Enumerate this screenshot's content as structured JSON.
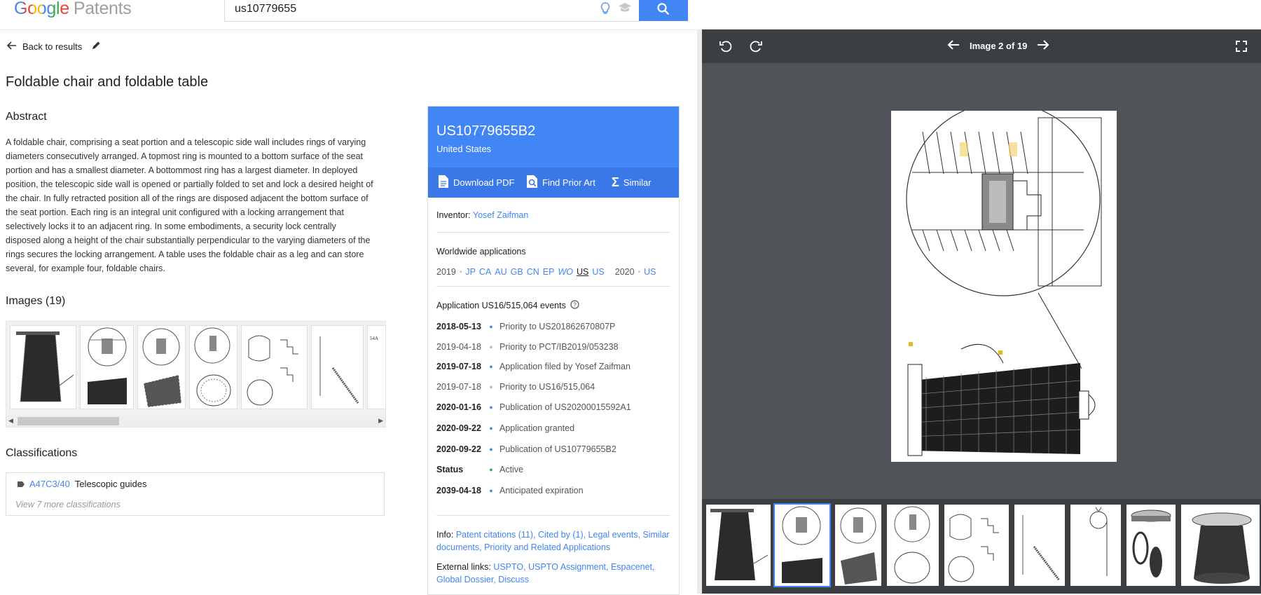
{
  "header": {
    "logo_google": "Google",
    "logo_product": "Patents",
    "search_value": "us10779655"
  },
  "left": {
    "back_label": "Back to results",
    "title": "Foldable chair and foldable table",
    "abstract_heading": "Abstract",
    "abstract_text": "A foldable chair, comprising a seat portion and a telescopic side wall includes rings of varying diameters consecutively arranged. A topmost ring is mounted to a bottom surface of the seat portion and has a smallest diameter. A bottommost ring has a largest diameter. In deployed position, the telescopic side wall is opened or partially folded to set and lock a desired height of the chair. In fully retracted position all of the rings are disposed adjacent the bottom surface of the seat portion. Each ring is an integral unit configured with a locking arrangement that selectively locks it to an adjacent ring. In some embodiments, a security lock centrally disposed along a height of the chair substantially perpendicular to the varying diameters of the rings secures the locking arrangement. A table uses the foldable chair as a leg and can store several, for example four, foldable chairs.",
    "images_heading": "Images (19)",
    "classifications_heading": "Classifications",
    "classification_code": "A47C3/40",
    "classification_desc": "Telescopic guides",
    "classification_more": "View 7 more classifications"
  },
  "card": {
    "patent_number": "US10779655B2",
    "country": "United States",
    "tools": {
      "download_pdf": "Download PDF",
      "find_prior_art": "Find Prior Art",
      "similar": "Similar"
    },
    "inventor_label": "Inventor:",
    "inventor_name": "Yosef Zaifman",
    "worldwide_heading": "Worldwide applications",
    "worldwide_2019": "2019",
    "worldwide_2019_countries": [
      "JP",
      "CA",
      "AU",
      "GB",
      "CN",
      "EP",
      "WO",
      "US",
      "US"
    ],
    "worldwide_2020": "2020",
    "worldwide_2020_countries": [
      "US"
    ],
    "events_heading": "Application US16/515,064 events",
    "events": [
      {
        "date": "2018-05-13",
        "text": "Priority to US201862670807P",
        "light": false
      },
      {
        "date": "2019-04-18",
        "text": "Priority to PCT/IB2019/053238",
        "light": true
      },
      {
        "date": "2019-07-18",
        "text": "Application filed by Yosef Zaifman",
        "light": false
      },
      {
        "date": "2019-07-18",
        "text": "Priority to US16/515,064",
        "light": true
      },
      {
        "date": "2020-01-16",
        "text": "Publication of US20200015592A1",
        "light": false
      },
      {
        "date": "2020-09-22",
        "text": "Application granted",
        "light": false
      },
      {
        "date": "2020-09-22",
        "text": "Publication of US10779655B2",
        "light": false
      },
      {
        "date": "Status",
        "text": "Active",
        "light": false
      },
      {
        "date": "2039-04-18",
        "text": "Anticipated expiration",
        "light": false
      }
    ],
    "info_label": "Info:",
    "info_links": "Patent citations (11), Cited by (1), Legal events, Similar documents, Priority and Related Applications",
    "external_label": "External links:",
    "external_links": "USPTO, USPTO Assignment, Espacenet, Global Dossier, Discuss"
  },
  "viewer": {
    "counter": "Image 2 of 19"
  },
  "colors": {
    "accent": "#4285f4",
    "card_tools": "#3b78e7",
    "viewer_bg": "#505357",
    "viewer_bar": "#3c3f42"
  }
}
